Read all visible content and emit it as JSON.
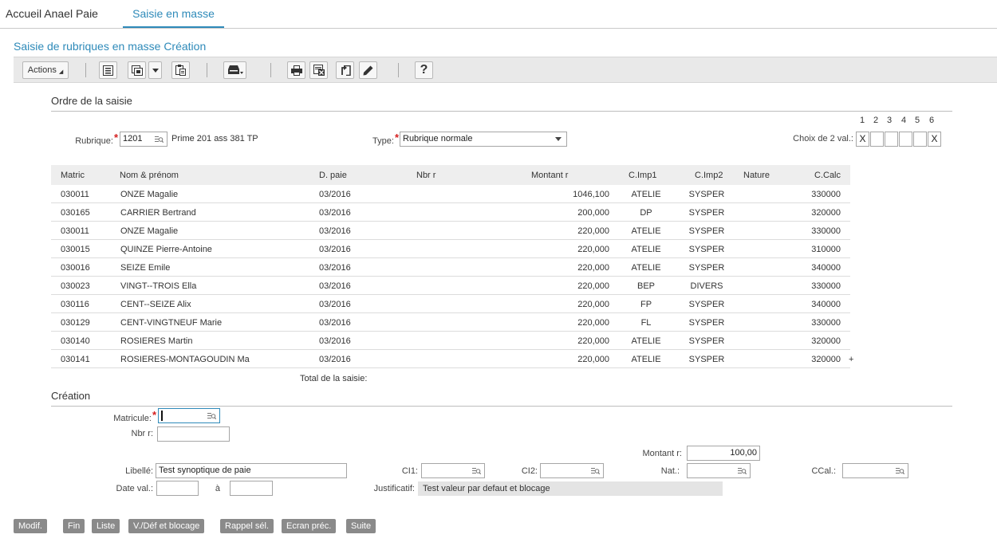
{
  "tabs": [
    {
      "label": "Accueil Anael Paie",
      "active": false
    },
    {
      "label": "Saisie en masse",
      "active": true
    }
  ],
  "page_title": "Saisie de rubriques en masse Création",
  "toolbar": {
    "actions_label": "Actions",
    "icons": [
      "list-icon",
      "window-icon",
      "dropdown-arrow-icon",
      "paste-icon",
      "printer-tray-icon",
      "printer-icon",
      "excel-icon",
      "export-icon",
      "pencil-icon",
      "help-icon"
    ],
    "help_label": "?"
  },
  "ordre": {
    "section_title": "Ordre de la saisie",
    "rubrique_label": "Rubrique:",
    "rubrique_value": "1201",
    "rubrique_desc": "Prime 201 ass 381 TP",
    "type_label": "Type:",
    "type_value": "Rubrique normale",
    "choix_label": "Choix de 2 val.:",
    "choix_numbers": [
      "1",
      "2",
      "3",
      "4",
      "5",
      "6"
    ],
    "choix_values": [
      "X",
      "",
      "",
      "",
      "",
      "X"
    ]
  },
  "table": {
    "headers": {
      "matric": "Matric",
      "nom": "Nom & prénom",
      "dpaie": "D. paie",
      "nbr": "Nbr   r",
      "montant": "Montant  r",
      "cimp1": "C.Imp1",
      "cimp2": "C.Imp2",
      "nature": "Nature",
      "ccalc": "C.Calc"
    },
    "rows": [
      {
        "matric": "030011",
        "nom": "ONZE Magalie",
        "dpaie": "03/2016",
        "montant": "1046,100",
        "cimp1": "ATELIE",
        "cimp2": "SYSPER",
        "ccalc": "330000"
      },
      {
        "matric": "030165",
        "nom": "CARRIER Bertrand",
        "dpaie": "03/2016",
        "montant": "200,000",
        "cimp1": "DP",
        "cimp2": "SYSPER",
        "ccalc": "320000"
      },
      {
        "matric": "030011",
        "nom": "ONZE Magalie",
        "dpaie": "03/2016",
        "montant": "220,000",
        "cimp1": "ATELIE",
        "cimp2": "SYSPER",
        "ccalc": "330000"
      },
      {
        "matric": "030015",
        "nom": "QUINZE Pierre-Antoine",
        "dpaie": "03/2016",
        "montant": "220,000",
        "cimp1": "ATELIE",
        "cimp2": "SYSPER",
        "ccalc": "310000"
      },
      {
        "matric": "030016",
        "nom": "SEIZE Emile",
        "dpaie": "03/2016",
        "montant": "220,000",
        "cimp1": "ATELIE",
        "cimp2": "SYSPER",
        "ccalc": "340000"
      },
      {
        "matric": "030023",
        "nom": "VINGT--TROIS Ella",
        "dpaie": "03/2016",
        "montant": "220,000",
        "cimp1": "BEP",
        "cimp2": "DIVERS",
        "ccalc": "330000"
      },
      {
        "matric": "030116",
        "nom": "CENT--SEIZE Alix",
        "dpaie": "03/2016",
        "montant": "220,000",
        "cimp1": "FP",
        "cimp2": "SYSPER",
        "ccalc": "340000"
      },
      {
        "matric": "030129",
        "nom": "CENT-VINGTNEUF Marie",
        "dpaie": "03/2016",
        "montant": "220,000",
        "cimp1": "FL",
        "cimp2": "SYSPER",
        "ccalc": "330000"
      },
      {
        "matric": "030140",
        "nom": "ROSIERES Martin",
        "dpaie": "03/2016",
        "montant": "220,000",
        "cimp1": "ATELIE",
        "cimp2": "SYSPER",
        "ccalc": "320000"
      },
      {
        "matric": "030141",
        "nom": "ROSIERES-MONTAGOUDIN Ma",
        "dpaie": "03/2016",
        "montant": "220,000",
        "cimp1": "ATELIE",
        "cimp2": "SYSPER",
        "ccalc": "320000"
      }
    ],
    "more_marker": "+",
    "total_label": "Total de la saisie:"
  },
  "creation": {
    "section_title": "Création",
    "matricule_label": "Matricule:",
    "matricule_value": "",
    "nbr_label": "Nbr   r:",
    "nbr_value": "",
    "montant_label": "Montant  r:",
    "montant_value": "100,00",
    "libelle_label": "Libellé:",
    "libelle_value": "Test synoptique de paie",
    "ci1_label": "CI1:",
    "ci2_label": "CI2:",
    "nat_label": "Nat.:",
    "ccal_label": "CCal.:",
    "dateval_label": "Date val.:",
    "a_label": "à",
    "justificatif_label": "Justificatif:",
    "justificatif_value": "Test valeur par defaut et blocage"
  },
  "buttons": [
    "Modif.",
    "Fin",
    "Liste",
    "V./Déf et blocage",
    "Rappel sél.",
    "Ecran préc.",
    "Suite"
  ],
  "colors": {
    "accent": "#2e8ab9",
    "required": "#d41e1e",
    "button_bg": "#8a8a8a"
  }
}
